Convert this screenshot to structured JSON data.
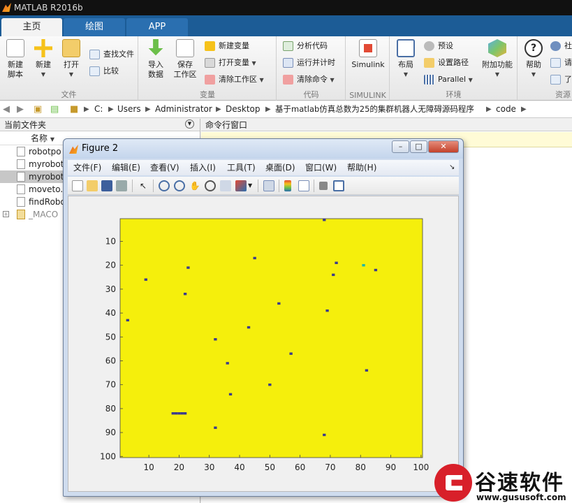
{
  "window": {
    "title": "MATLAB R2016b"
  },
  "tabs": [
    {
      "label": "主页",
      "active": true
    },
    {
      "label": "绘图",
      "active": false
    },
    {
      "label": "APP",
      "active": false
    }
  ],
  "toolstrip": {
    "file": {
      "label": "文件",
      "new_script": "新建\n脚本",
      "new": "新建",
      "open": "打开",
      "find_files": "查找文件",
      "compare": "比较"
    },
    "variable": {
      "label": "变量",
      "import_data": "导入\n数据",
      "save_workspace": "保存\n工作区",
      "new_variable": "新建变量",
      "open_variable": "打开变量",
      "clear_workspace": "清除工作区"
    },
    "code": {
      "label": "代码",
      "analyze_code": "分析代码",
      "run_and_time": "运行并计时",
      "clear_commands": "清除命令"
    },
    "simulink": {
      "label": "SIMULINK",
      "simulink": "Simulink"
    },
    "environment": {
      "label": "环境",
      "layout": "布局",
      "preferences": "预设",
      "set_path": "设置路径",
      "parallel": "Parallel",
      "addons": "附加功能"
    },
    "resources": {
      "label": "资源",
      "help": "帮助",
      "community": "社",
      "request": "请",
      "learn": "了"
    }
  },
  "address": {
    "crumbs": [
      "C:",
      "Users",
      "Administrator",
      "Desktop",
      "基于matlab仿真总数为25的集群机器人无障碍源码程序",
      "code"
    ]
  },
  "file_panel": {
    "title": "当前文件夹",
    "column": "名称",
    "files": [
      {
        "name": "robotpo",
        "selected": false
      },
      {
        "name": "myrobot",
        "selected": false
      },
      {
        "name": "myrobot",
        "selected": true
      },
      {
        "name": "moveto.",
        "selected": false
      },
      {
        "name": "findRobo",
        "selected": false
      },
      {
        "name": "_MACO",
        "selected": false
      }
    ]
  },
  "command_panel": {
    "title": "命令行窗口"
  },
  "figure": {
    "title": "Figure 2",
    "menu": [
      "文件(F)",
      "编辑(E)",
      "查看(V)",
      "插入(I)",
      "工具(T)",
      "桌面(D)",
      "窗口(W)",
      "帮助(H)"
    ],
    "buttons": {
      "minimize": "–",
      "maximize": "□",
      "close": "✕"
    }
  },
  "chart_data": {
    "type": "heatmap",
    "xlim": [
      0.5,
      100.5
    ],
    "ylim": [
      0.5,
      100.5
    ],
    "y_reversed": true,
    "xticks": [
      10,
      20,
      30,
      40,
      50,
      60,
      70,
      80,
      90,
      100
    ],
    "yticks": [
      10,
      20,
      30,
      40,
      50,
      60,
      70,
      80,
      90,
      100
    ],
    "background_color": "#f5ef0c",
    "cell_color": "#3b3b8c",
    "highlight_color": "#1fb8a8",
    "cells": [
      [
        68,
        1
      ],
      [
        45,
        17
      ],
      [
        72,
        19
      ],
      [
        23,
        21
      ],
      [
        85,
        22
      ],
      [
        71,
        24
      ],
      [
        9,
        26
      ],
      [
        22,
        32
      ],
      [
        53,
        36
      ],
      [
        69,
        39
      ],
      [
        3,
        43
      ],
      [
        43,
        46
      ],
      [
        32,
        51
      ],
      [
        57,
        57
      ],
      [
        36,
        61
      ],
      [
        82,
        64
      ],
      [
        50,
        70
      ],
      [
        37,
        74
      ],
      [
        32,
        88
      ],
      [
        68,
        91
      ],
      [
        18,
        82
      ],
      [
        19,
        82
      ],
      [
        20,
        82
      ],
      [
        21,
        82
      ],
      [
        22,
        82
      ]
    ],
    "highlight_cells": [
      [
        81,
        20
      ]
    ]
  },
  "watermark": {
    "text": "谷速软件",
    "url": "www.gususoft.com"
  }
}
